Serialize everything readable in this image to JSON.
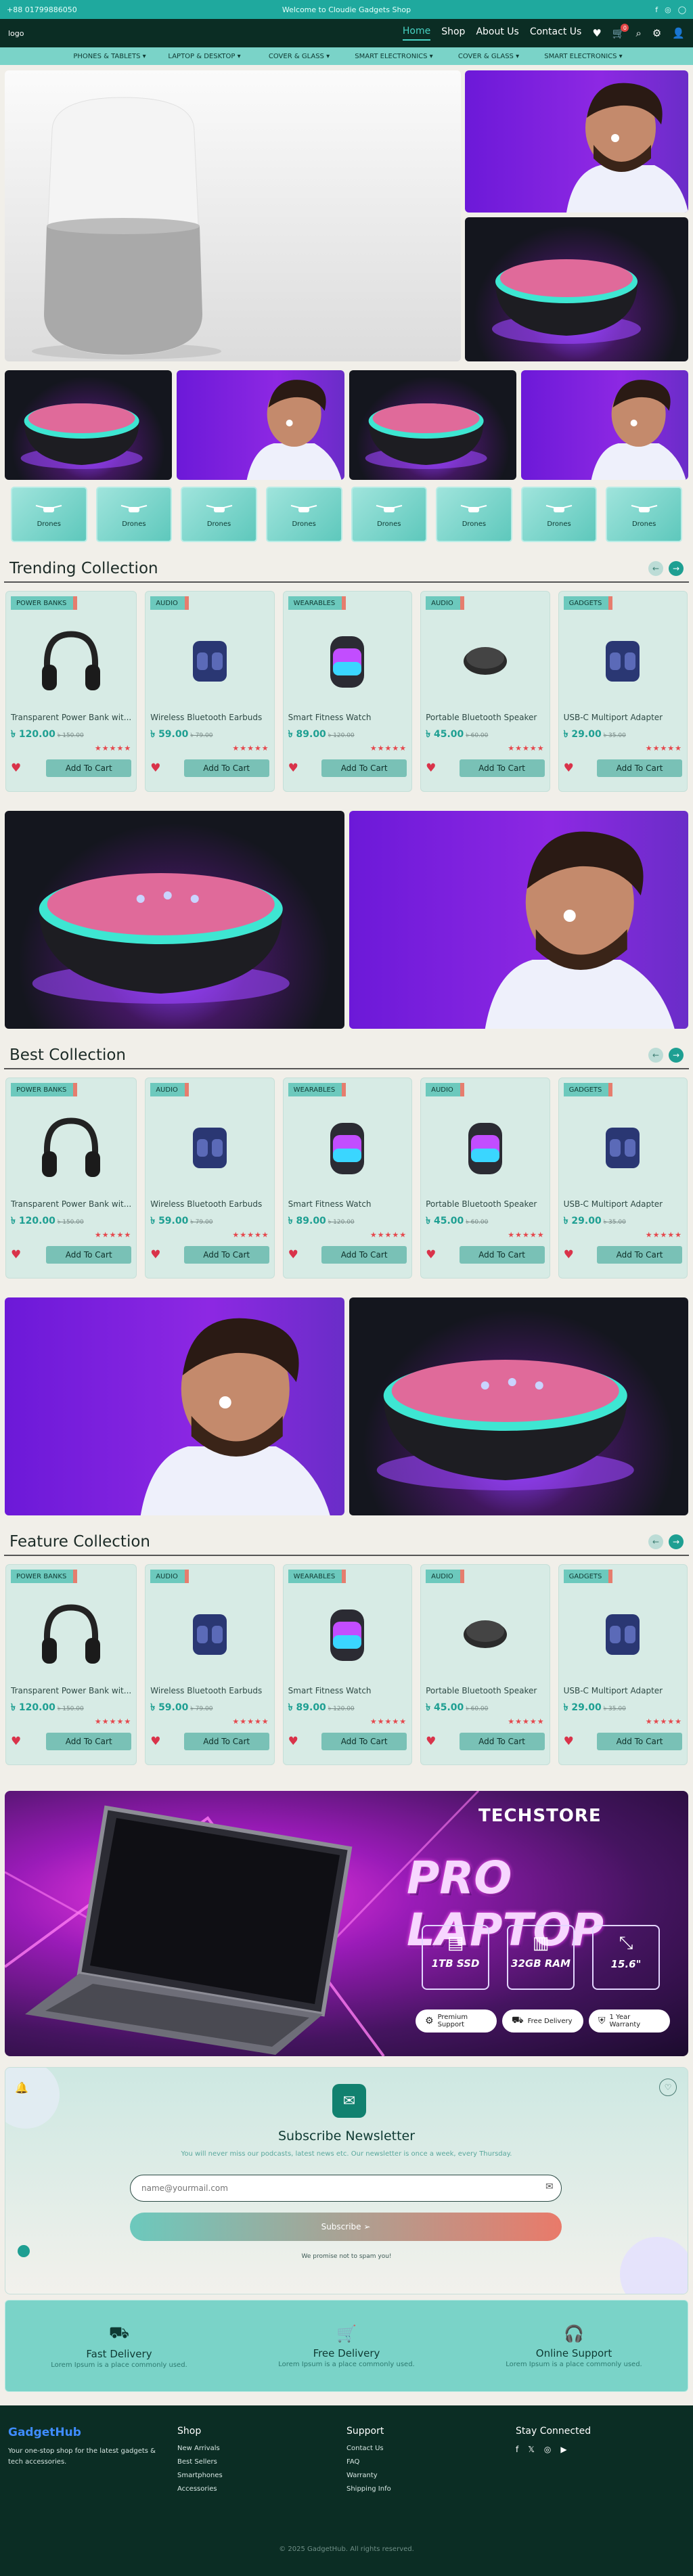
{
  "topbar": {
    "phone": "+88 01799886050",
    "welcome": "Welcome to Cloudie Gadgets Shop",
    "social": [
      "f",
      "◎",
      "◯"
    ]
  },
  "nav": {
    "logo": "logo",
    "links": [
      "Home",
      "Shop",
      "About Us",
      "Contact Us"
    ],
    "cart_count": "0"
  },
  "categories": [
    "PHONES & TABLETS ▾",
    "LAPTOP & DESKTOP ▾",
    "COVER & GLASS ▾",
    "SMART ELECTRONICS ▾",
    "COVER & GLASS ▾",
    "SMART ELECTRONICS ▾"
  ],
  "drones": [
    "Drones",
    "Drones",
    "Drones",
    "Drones",
    "Drones",
    "Drones",
    "Drones",
    "Drones"
  ],
  "sections": {
    "trending": "Trending Collection",
    "best": "Best Collection",
    "feature": "Feature Collection"
  },
  "products": [
    {
      "tag": "POWER BANKS",
      "name": "Transparent Power Bank wit...",
      "price": "৳ 120.00",
      "old": "৳ 150.00",
      "stars": "★★★★★",
      "btn": "Add To Cart"
    },
    {
      "tag": "AUDIO",
      "name": "Wireless Bluetooth Earbuds",
      "price": "৳ 59.00",
      "old": "৳ 79.00",
      "stars": "★★★★★",
      "btn": "Add To Cart"
    },
    {
      "tag": "WEARABLES",
      "name": "Smart Fitness Watch",
      "price": "৳ 89.00",
      "old": "৳ 120.00",
      "stars": "★★★★★",
      "btn": "Add To Cart"
    },
    {
      "tag": "AUDIO",
      "name": "Portable Bluetooth Speaker",
      "price": "৳ 45.00",
      "old": "৳ 60.00",
      "stars": "★★★★★",
      "btn": "Add To Cart"
    },
    {
      "tag": "GADGETS",
      "name": "USB-C Multiport Adapter",
      "price": "৳ 29.00",
      "old": "৳ 35.00",
      "stars": "★★★★★",
      "btn": "Add To Cart"
    }
  ],
  "promo": {
    "brand": "TECHSTORE",
    "title": "PRO LAPTOP",
    "specs": [
      "1TB SSD",
      "32GB RAM",
      "15.6\""
    ],
    "pills": [
      "Premium Support",
      "Free Delivery",
      "1 Year Warranty"
    ]
  },
  "newsletter": {
    "title": "Subscribe Newsletter",
    "desc": "You will never miss our podcasts, latest news etc. Our newsletter is once a week, every Thursday.",
    "placeholder": "name@yourmail.com",
    "button": "Subscribe",
    "note": "We promise not to spam you!"
  },
  "features": [
    {
      "icon": "truck-icon",
      "title": "Fast Delivery",
      "desc": "Lorem Ipsum is a place commonly used."
    },
    {
      "icon": "cart-icon",
      "title": "Free Delivery",
      "desc": "Lorem Ipsum is a place commonly used."
    },
    {
      "icon": "headphones-icon",
      "title": "Online Support",
      "desc": "Lorem Ipsum is a place commonly used."
    }
  ],
  "footer": {
    "brand": "GadgetHub",
    "about": "Your one-stop shop for the latest gadgets & tech accessories.",
    "shop_title": "Shop",
    "shop": [
      "New Arrivals",
      "Best Sellers",
      "Smartphones",
      "Accessories"
    ],
    "support_title": "Support",
    "support": [
      "Contact Us",
      "FAQ",
      "Warranty",
      "Shipping Info"
    ],
    "connect_title": "Stay Connected",
    "social": [
      "f",
      "𝕏",
      "◎",
      "▶"
    ],
    "copyright": "© 2025 GadgetHub. All rights reserved."
  },
  "colors": {
    "accent": "#1fa99e",
    "dark": "#0b2d24",
    "coral": "#e97a6a"
  }
}
